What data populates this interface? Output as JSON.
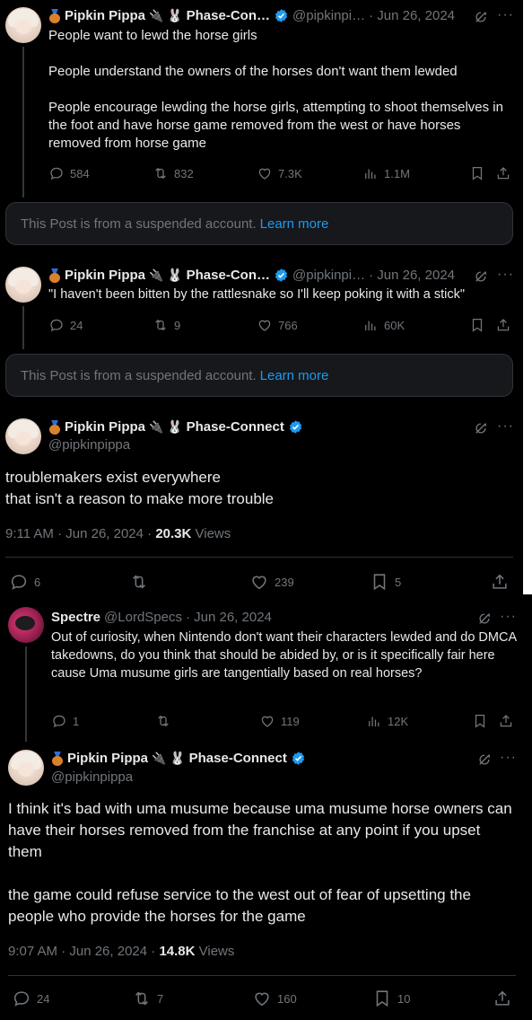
{
  "posts": {
    "p1": {
      "name": "Pipkin Pippa",
      "affiliation": "Phase-Con…",
      "handle": "@pipkinpi…",
      "date": "· Jun 26, 2024",
      "text": "People want to lewd the horse girls\n\nPeople understand the owners of the horses don't want them lewded\n\nPeople encourage lewding the horse girls, attempting to shoot themselves in the foot and have horse game removed from the west or have horses removed from horse game",
      "replies": "584",
      "reposts": "832",
      "likes": "7.3K",
      "views": "1.1M"
    },
    "p2": {
      "name": "Pipkin Pippa",
      "affiliation": "Phase-Con…",
      "handle": "@pipkinpi…",
      "date": "· Jun 26, 2024",
      "text": "\"I haven't been bitten by the rattlesnake so I'll keep poking it with a stick\"",
      "replies": "24",
      "reposts": "9",
      "likes": "766",
      "views": "60K"
    },
    "main": {
      "name": "Pipkin Pippa",
      "affiliation": "Phase-Connect",
      "handle": "@pipkinpippa",
      "text": "troublemakers exist everywhere\nthat isn't a reason to make more trouble",
      "time": "9:11 AM · Jun 26, 2024 · ",
      "views_count": "20.3K",
      "views_label": " Views",
      "replies": "6",
      "likes": "239",
      "bookmarks": "5"
    },
    "spectre": {
      "name": "Spectre",
      "handle": "@LordSpecs",
      "date": "· Jun 26, 2024",
      "text": "Out of curiosity, when Nintendo don't want their characters lewded and do DMCA takedowns, do you think that should be abided by, or is it specifically fair here cause Uma musume girls are tangentially based on real horses?",
      "replies": "1",
      "likes": "119",
      "views": "12K"
    },
    "main2": {
      "name": "Pipkin Pippa",
      "affiliation": "Phase-Connect",
      "handle": "@pipkinpippa",
      "text": "I think it's bad with uma musume because uma musume horse owners can have their horses removed from the franchise at any point if you upset them\n\nthe game could refuse service to the west out of fear of upsetting the people who provide the horses for the game",
      "time": "9:07 AM · Jun 26, 2024 · ",
      "views_count": "14.8K",
      "views_label": " Views",
      "replies": "24",
      "reposts": "7",
      "likes": "160",
      "bookmarks": "10"
    }
  },
  "suspended": {
    "message": "This Post is from a suspended account.",
    "learn_more": "Learn more"
  },
  "icons": {
    "plug": "plug-icon",
    "bunny": "bunny-icon",
    "verified": "verified-badge-icon",
    "more": "more-icon",
    "grok": "grok-icon"
  },
  "glyphs": {
    "plug": "🔌",
    "bunny": "🐰",
    "more": "···"
  },
  "colors": {
    "background": "#000000",
    "accent": "#1d9bf0",
    "muted": "#71767b"
  }
}
